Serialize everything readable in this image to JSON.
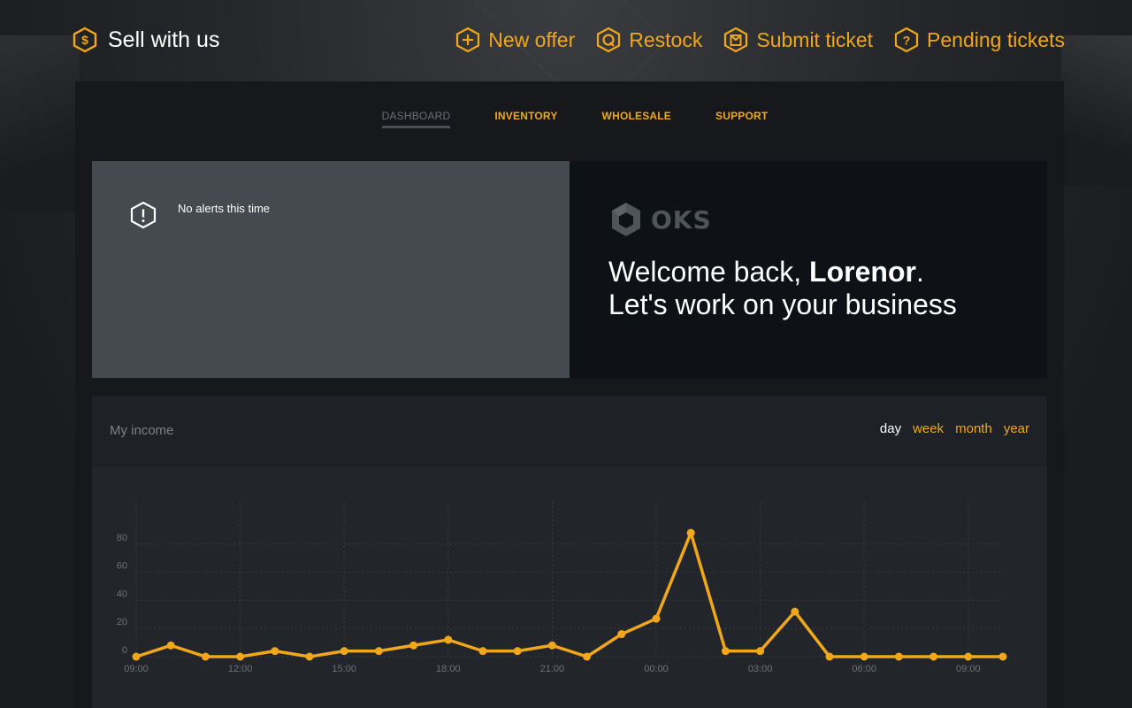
{
  "brand": {
    "label": "Sell with us",
    "icon": "dollar-hex-icon"
  },
  "top_nav": [
    {
      "label": "New offer",
      "icon": "plus-hex-icon"
    },
    {
      "label": "Restock",
      "icon": "q-hex-icon"
    },
    {
      "label": "Submit ticket",
      "icon": "ticket-hex-icon"
    },
    {
      "label": "Pending tickets",
      "icon": "question-hex-icon"
    }
  ],
  "tabs": [
    {
      "label": "DASHBOARD",
      "active": true
    },
    {
      "label": "INVENTORY",
      "active": false
    },
    {
      "label": "WHOLESALE",
      "active": false
    },
    {
      "label": "SUPPORT",
      "active": false
    }
  ],
  "alerts": {
    "text": "No alerts this time",
    "icon": "alert-hex-icon"
  },
  "welcome": {
    "logo_text": "OKS",
    "line1_prefix": "Welcome back, ",
    "user_name": "Lorenor",
    "line1_suffix": ".",
    "line2": "Let's work on your business"
  },
  "income": {
    "title": "My income",
    "ranges": [
      {
        "label": "day",
        "active": true
      },
      {
        "label": "week",
        "active": false
      },
      {
        "label": "month",
        "active": false
      },
      {
        "label": "year",
        "active": false
      }
    ]
  },
  "colors": {
    "accent": "#f0a81a",
    "panel": "#16181b",
    "card": "#22252a"
  },
  "chart_data": {
    "type": "line",
    "x": [
      "09:00",
      "10:00",
      "11:00",
      "12:00",
      "13:00",
      "14:00",
      "15:00",
      "16:00",
      "17:00",
      "18:00",
      "19:00",
      "20:00",
      "21:00",
      "22:00",
      "23:00",
      "00:00",
      "01:00",
      "02:00",
      "03:00",
      "04:00",
      "05:00",
      "06:00",
      "07:00",
      "08:00",
      "09:00",
      "10:00"
    ],
    "x_tick_labels": [
      "09:00",
      "12:00",
      "15:00",
      "18:00",
      "21:00",
      "00:00",
      "03:00",
      "06:00",
      "09:00"
    ],
    "y_ticks": [
      0,
      20,
      40,
      60,
      80
    ],
    "series": [
      {
        "values": [
          0,
          8,
          0,
          0,
          4,
          0,
          4,
          4,
          8,
          12,
          4,
          4,
          8,
          0,
          16,
          27,
          88,
          4,
          4,
          32,
          0,
          0,
          0,
          0,
          0,
          0
        ]
      }
    ],
    "ylim": [
      0,
      100
    ],
    "grid": true
  }
}
